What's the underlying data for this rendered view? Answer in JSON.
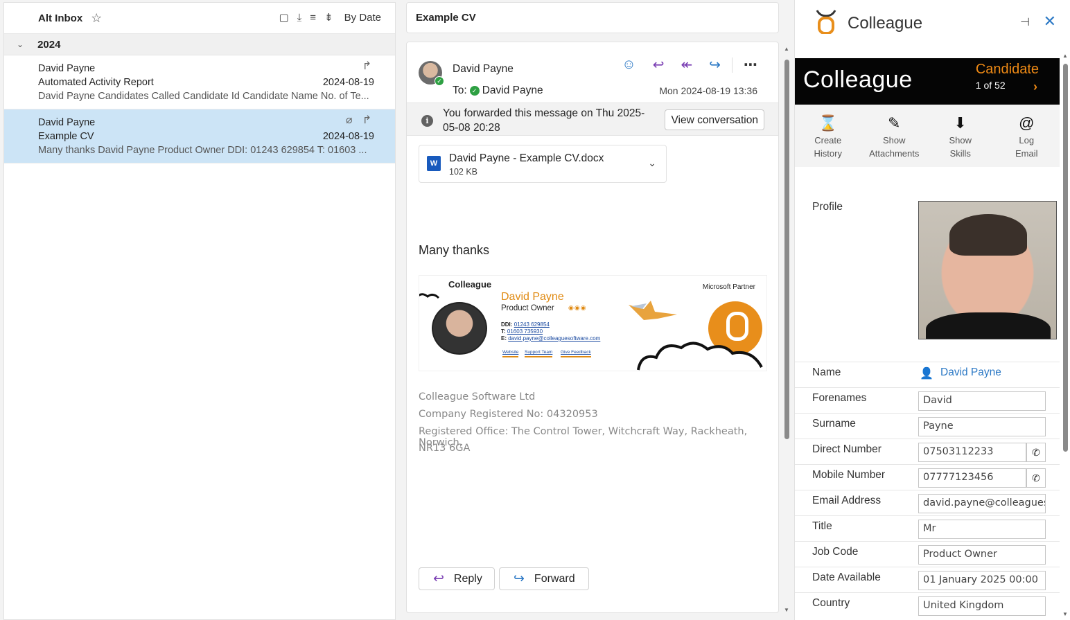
{
  "list": {
    "title": "Alt Inbox",
    "sort_label": "By Date",
    "group": "2024",
    "items": [
      {
        "sender": "David Payne",
        "subject": "Automated Activity Report",
        "date": "2024-08-19",
        "preview": "David Payne Candidates Called Candidate Id Candidate Name No. of Te..."
      },
      {
        "sender": "David Payne",
        "subject": "Example CV",
        "date": "2024-08-19",
        "preview": "Many thanks David Payne Product Owner DDI: 01243 629854 T: 01603 ..."
      }
    ]
  },
  "reading": {
    "subject": "Example CV",
    "from": "David Payne",
    "to_label": "To:",
    "to": "David Payne",
    "date": "Mon 2024-08-19 13:36",
    "forward_info": "You forwarded this message on Thu 2025-05-08 20:28",
    "view_conversation": "View conversation",
    "attachment": {
      "name": "David Payne - Example CV.docx",
      "size": "102 KB"
    },
    "body": "Many thanks",
    "signature": {
      "logo": "Colleague",
      "name": "David Payne",
      "role": "Product Owner",
      "ddi_label": "DDI:",
      "ddi": "01243 629854",
      "t_label": "T:",
      "t": "01603 735930",
      "e_label": "E:",
      "e": "david.payne@colleaguesoftware.com",
      "links": [
        "Website",
        "Support Team",
        "Give Feedback"
      ],
      "partner": "Microsoft Partner"
    },
    "footer": [
      "Colleague Software Ltd",
      "Company Registered No: 04320953",
      "Registered Office: The Control Tower, Witchcraft Way, Rackheath, Norwich,",
      "NR13 6GA"
    ],
    "reply": "Reply",
    "forward": "Forward"
  },
  "addin": {
    "title": "Colleague",
    "brand": "Colleague",
    "record_type": "Candidate",
    "record_count": "1 of 52",
    "tools": [
      {
        "line1": "Create",
        "line2": "History",
        "icon": "hourglass-icon"
      },
      {
        "line1": "Show",
        "line2": "Attachments",
        "icon": "paperclip-icon"
      },
      {
        "line1": "Show",
        "line2": "Skills",
        "icon": "down-arrow-icon"
      },
      {
        "line1": "Log",
        "line2": "Email",
        "icon": "at-icon"
      }
    ],
    "profile_label": "Profile",
    "name_label": "Name",
    "name_value": "David Payne",
    "fields": [
      {
        "label": "Forenames",
        "value": "David"
      },
      {
        "label": "Surname",
        "value": "Payne"
      },
      {
        "label": "Direct Number",
        "value": "07503112233"
      },
      {
        "label": "Mobile Number",
        "value": "07777123456"
      },
      {
        "label": "Email Address",
        "value": "david.payne@colleagues"
      },
      {
        "label": "Title",
        "value": "Mr"
      },
      {
        "label": "Job Code",
        "value": "Product Owner"
      },
      {
        "label": "Date Available",
        "value": "01 January 2025 00:00"
      },
      {
        "label": "Country",
        "value": "United Kingdom"
      }
    ]
  },
  "colors": {
    "accent": "#2b78c5",
    "reply": "#7a3eb3",
    "brand_orange": "#ef8a15",
    "selected_row": "#cce4f6"
  }
}
